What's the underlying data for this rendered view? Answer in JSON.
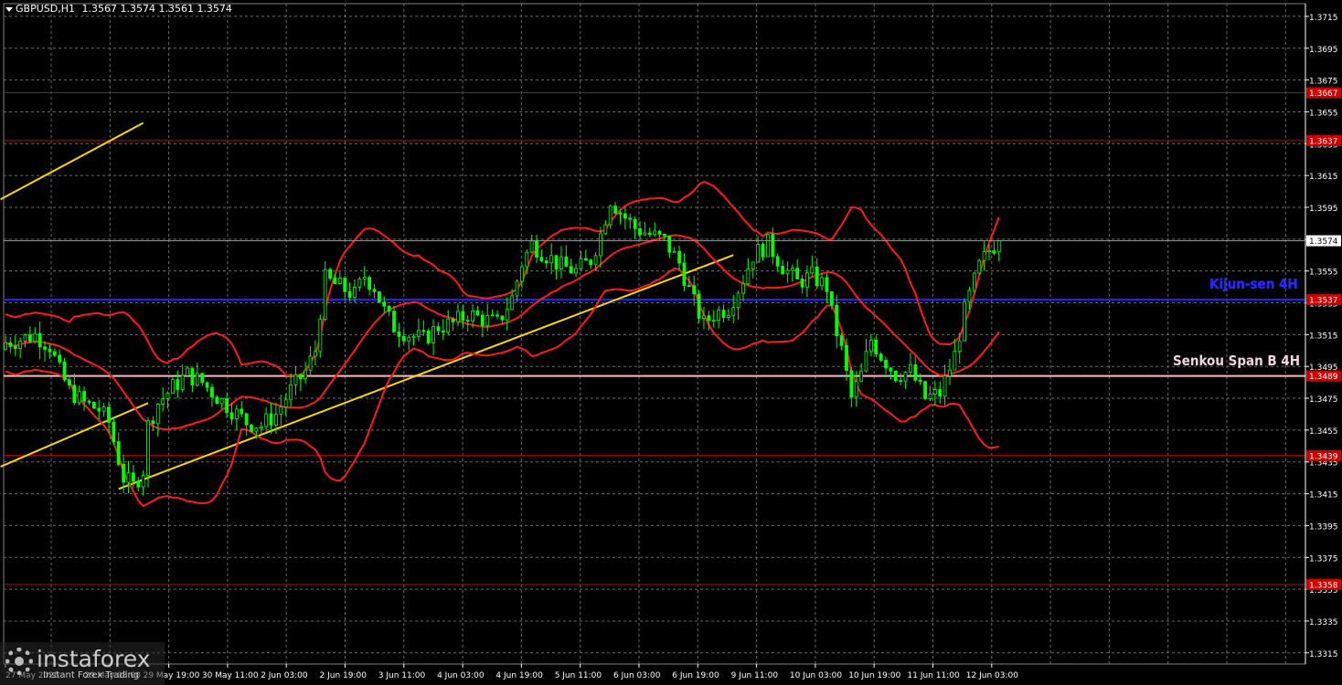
{
  "header": {
    "symbol": "GBPUSD,H1",
    "ohlc": "1.3567 1.3574 1.3561 1.3574"
  },
  "labels": {
    "kijun": "Kijun-sen 4H",
    "senkou": "Senkou Span B 4H"
  },
  "logo": {
    "brand": "instaforex",
    "sub": "Instant Forex Trading"
  },
  "colors": {
    "background": "#000000",
    "candles": "#00ff00",
    "bollinger": "#ff1a1a",
    "trendline": "#ffd700",
    "kijun_line": "#2020ff",
    "senkou_line": "#ffb6c1",
    "level_lines": "#cc0000",
    "grid": "#6b6b6b"
  },
  "chart_data": {
    "type": "candlestick",
    "symbol": "GBPUSD",
    "timeframe": "H1",
    "ylim": [
      1.3308,
      1.3723
    ],
    "y_ticks": [
      1.3315,
      1.3335,
      1.3355,
      1.3375,
      1.3395,
      1.3415,
      1.3435,
      1.3455,
      1.3475,
      1.3495,
      1.3515,
      1.3535,
      1.3555,
      1.3575,
      1.3595,
      1.3615,
      1.3635,
      1.3655,
      1.3675,
      1.3695,
      1.3715
    ],
    "x_ticks": [
      "27 May 2025",
      "29 May 03:00",
      "29 May 19:00",
      "30 May 11:00",
      "2 Jun 03:00",
      "2 Jun 19:00",
      "3 Jun 11:00",
      "4 Jun 03:00",
      "4 Jun 19:00",
      "5 Jun 11:00",
      "6 Jun 03:00",
      "6 Jun 19:00",
      "9 Jun 11:00",
      "10 Jun 03:00",
      "10 Jun 19:00",
      "11 Jun 11:00",
      "12 Jun 03:00"
    ],
    "levels": [
      {
        "value": 1.3667,
        "label": "1.3667",
        "style": "level"
      },
      {
        "value": 1.3637,
        "label": "1.3637",
        "style": "level"
      },
      {
        "value": 1.3537,
        "label": "1.3537",
        "style": "kijun"
      },
      {
        "value": 1.3489,
        "label": "1.3489",
        "style": "senkou"
      },
      {
        "value": 1.3439,
        "label": "1.3439",
        "style": "level"
      },
      {
        "value": 1.3358,
        "label": "1.3358",
        "style": "level"
      }
    ],
    "current_price": {
      "value": 1.3574,
      "label": "1.3574"
    },
    "close_path": [
      [
        0,
        1.351
      ],
      [
        3,
        1.3512
      ],
      [
        6,
        1.3515
      ],
      [
        9,
        1.3508
      ],
      [
        11,
        1.3492
      ],
      [
        13,
        1.348
      ],
      [
        16,
        1.3472
      ],
      [
        19,
        1.3468
      ],
      [
        21,
        1.346
      ],
      [
        24,
        1.3425
      ],
      [
        26,
        1.342
      ],
      [
        28,
        1.343
      ],
      [
        29,
        1.3458
      ],
      [
        31,
        1.3472
      ],
      [
        34,
        1.3482
      ],
      [
        37,
        1.349
      ],
      [
        40,
        1.3485
      ],
      [
        43,
        1.3476
      ],
      [
        46,
        1.3468
      ],
      [
        49,
        1.346
      ],
      [
        52,
        1.3458
      ],
      [
        55,
        1.3465
      ],
      [
        58,
        1.348
      ],
      [
        61,
        1.3492
      ],
      [
        63,
        1.3505
      ],
      [
        64,
        1.353
      ],
      [
        65,
        1.355
      ],
      [
        68,
        1.3545
      ],
      [
        71,
        1.354
      ],
      [
        73,
        1.3552
      ],
      [
        75,
        1.3545
      ],
      [
        77,
        1.353
      ],
      [
        79,
        1.352
      ],
      [
        82,
        1.3515
      ],
      [
        85,
        1.3512
      ],
      [
        88,
        1.352
      ],
      [
        91,
        1.3522
      ],
      [
        94,
        1.3528
      ],
      [
        97,
        1.3525
      ],
      [
        100,
        1.3522
      ],
      [
        103,
        1.3538
      ],
      [
        105,
        1.356
      ],
      [
        107,
        1.3572
      ],
      [
        110,
        1.3565
      ],
      [
        113,
        1.3558
      ],
      [
        116,
        1.3555
      ],
      [
        119,
        1.3562
      ],
      [
        121,
        1.3578
      ],
      [
        123,
        1.36
      ],
      [
        125,
        1.3592
      ],
      [
        128,
        1.3582
      ],
      [
        131,
        1.3578
      ],
      [
        134,
        1.3574
      ],
      [
        137,
        1.356
      ],
      [
        140,
        1.3535
      ],
      [
        142,
        1.3522
      ],
      [
        144,
        1.3528
      ],
      [
        147,
        1.3532
      ],
      [
        150,
        1.355
      ],
      [
        152,
        1.3565
      ],
      [
        155,
        1.3572
      ],
      [
        158,
        1.3558
      ],
      [
        161,
        1.3548
      ],
      [
        164,
        1.3552
      ],
      [
        167,
        1.3545
      ],
      [
        168,
        1.3528
      ],
      [
        170,
        1.3505
      ],
      [
        172,
        1.3475
      ],
      [
        174,
        1.349
      ],
      [
        176,
        1.3512
      ],
      [
        178,
        1.3502
      ],
      [
        181,
        1.349
      ],
      [
        184,
        1.3492
      ],
      [
        187,
        1.3475
      ],
      [
        190,
        1.3478
      ],
      [
        193,
        1.3502
      ],
      [
        195,
        1.353
      ],
      [
        198,
        1.3558
      ],
      [
        200,
        1.3568
      ],
      [
        202,
        1.3574
      ]
    ],
    "trendlines": [
      {
        "from": [
          -1,
          1.36
        ],
        "to": [
          28,
          1.3648
        ]
      },
      {
        "from": [
          -1,
          1.3432
        ],
        "to": [
          29,
          1.3472
        ]
      },
      {
        "from": [
          23,
          1.3418
        ],
        "to": [
          148,
          1.3565
        ]
      }
    ]
  }
}
